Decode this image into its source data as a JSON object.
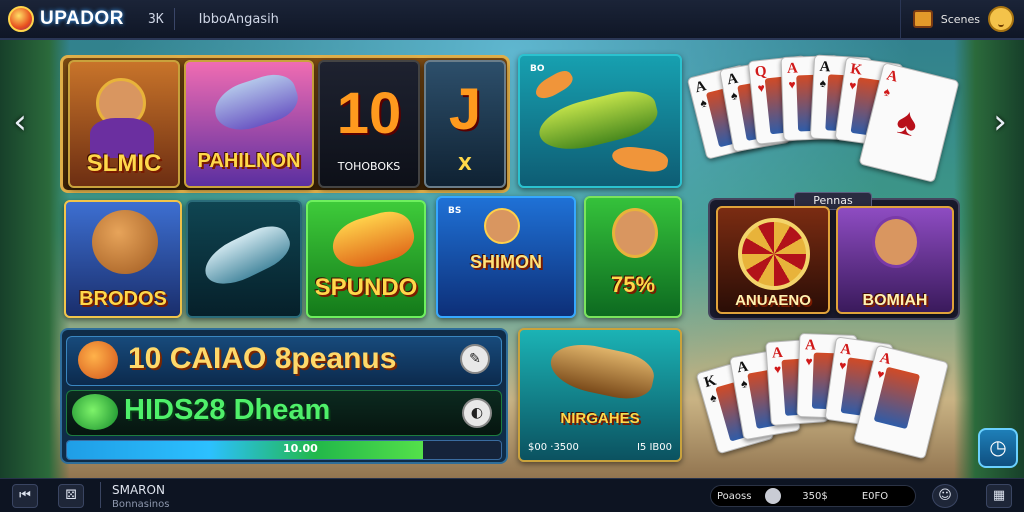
{
  "header": {
    "logo_text": "UPADOR",
    "code": "3K",
    "title": "IbboAngasih",
    "user_label": "Scenes"
  },
  "tiles": {
    "slmic": "SLMIC",
    "pahilnon": "PAHILNON",
    "ten_big": "10",
    "ten_sub": "TOHOBOKS",
    "j_big": "J",
    "j_sub": "X",
    "fish_tag": "BO",
    "brodos": "BRODOS",
    "spundo": "SPUNDO",
    "shimon_tag": "BS",
    "shimon": "SHIMON",
    "percent": "75%",
    "nirgahes": "NIRGAHES",
    "nir_left": "$00 ·3500",
    "nir_right": "I5 IB00"
  },
  "right_panel": {
    "head": "Pennas",
    "anuaeno": "ANUAENO",
    "bomiah": "BOMIAH"
  },
  "promo": {
    "row1": "10 CAIAO 8peanus",
    "row2": "HIDS28 Dheam",
    "progress_text": "10.00",
    "progress_fraction": 0.82
  },
  "cards_top": [
    {
      "rank": "A",
      "suit": "♠",
      "color": "blk"
    },
    {
      "rank": "A",
      "suit": "♠",
      "color": "blk"
    },
    {
      "rank": "Q",
      "suit": "♥",
      "color": "red"
    },
    {
      "rank": "A",
      "suit": "♥",
      "color": "red"
    },
    {
      "rank": "A",
      "suit": "♠",
      "color": "blk"
    },
    {
      "rank": "K",
      "suit": "♥",
      "color": "red"
    },
    {
      "rank": "A",
      "suit": "♠",
      "color": "red"
    }
  ],
  "cards_bottom": [
    {
      "rank": "K",
      "suit": "♠",
      "color": "blk"
    },
    {
      "rank": "A",
      "suit": "♠",
      "color": "blk"
    },
    {
      "rank": "A",
      "suit": "♥",
      "color": "red"
    },
    {
      "rank": "A",
      "suit": "♥",
      "color": "red"
    },
    {
      "rank": "A",
      "suit": "♥",
      "color": "red"
    },
    {
      "rank": "A",
      "suit": "♥",
      "color": "red"
    }
  ],
  "footer": {
    "title": "SMARON",
    "subtitle": "Bonnasinos",
    "label": "Poaoss",
    "value_a": "350$",
    "value_b": "E0FO"
  },
  "icons": {
    "left_arrow": "chevron-left-icon",
    "right_arrow": "chevron-right-icon"
  }
}
